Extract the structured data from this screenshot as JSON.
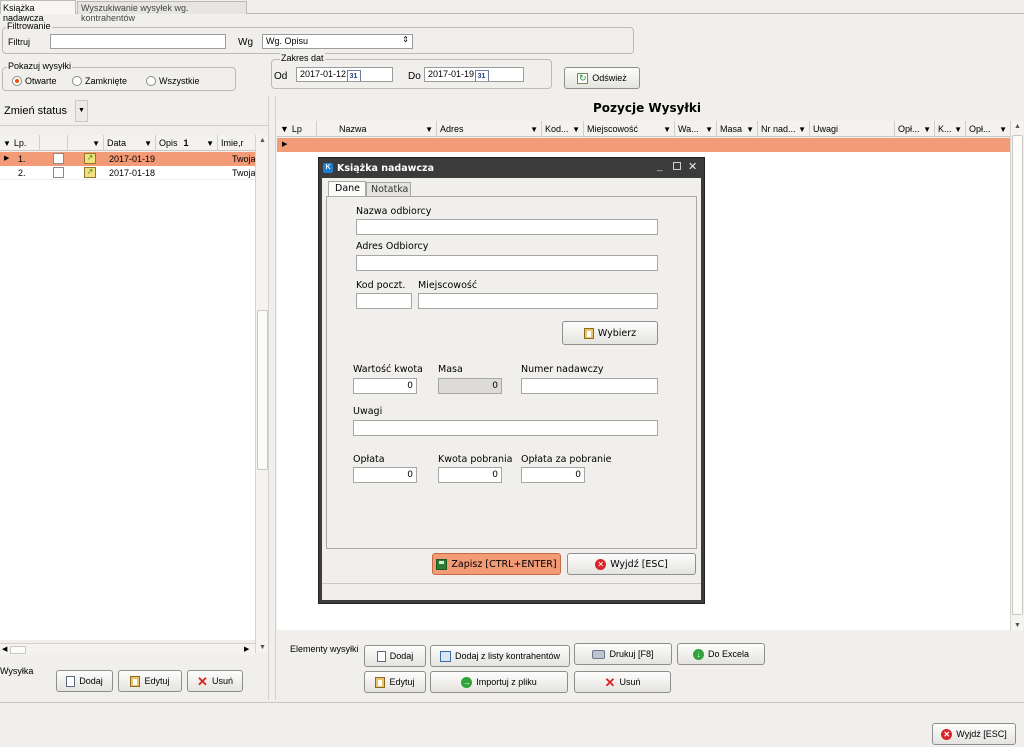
{
  "tabs": [
    {
      "label": "Książka nadawcza",
      "active": true
    },
    {
      "label": "Wyszukiwanie wysyłek wg. kontrahentów",
      "active": false
    }
  ],
  "filter": {
    "group_label": "Filtrowanie",
    "filtruj_label": "Filtruj",
    "filtruj_value": "",
    "wg_label": "Wg",
    "wg_value": "Wg. Opisu"
  },
  "show": {
    "group_label": "Pokazuj wysyłki",
    "options": [
      {
        "label": "Otwarte",
        "selected": true
      },
      {
        "label": "Zamknięte",
        "selected": false
      },
      {
        "label": "Wszystkie",
        "selected": false
      }
    ]
  },
  "dates": {
    "group_label": "Zakres dat",
    "from_label": "Od",
    "from_value": "2017-01-12",
    "to_label": "Do",
    "to_value": "2017-01-19",
    "cal_glyph": "31"
  },
  "refresh_label": "Odśwież",
  "status_label": "Zmień status",
  "left_table": {
    "headers": [
      "Lp.",
      "",
      "",
      "Data",
      "Opis",
      "Imie,r"
    ],
    "sort_glyph": "1",
    "rows": [
      {
        "lp": "1.",
        "date": "2017-01-19",
        "opis": "",
        "imie": "Twoja",
        "selected": true
      },
      {
        "lp": "2.",
        "date": "2017-01-18",
        "opis": "",
        "imie": "Twoja",
        "selected": false
      }
    ]
  },
  "left_bottom": {
    "label": "Wysyłka",
    "add": "Dodaj",
    "edit": "Edytuj",
    "delete": "Usuń"
  },
  "right": {
    "title": "Pozycje Wysyłki",
    "headers": [
      "Lp",
      "Nazwa",
      "Adres",
      "Kod...",
      "Miejscowość",
      "Wa...",
      "Masa",
      "Nr nad...",
      "Uwagi",
      "Opł...",
      "K...",
      "Opł..."
    ]
  },
  "elements": {
    "label": "Elementy wysyłki",
    "add": "Dodaj",
    "add_from_list": "Dodaj z listy kontrahentów",
    "print": "Drukuj  [F8]",
    "excel": "Do Excela",
    "edit": "Edytuj",
    "import": "Importuj z pliku",
    "delete": "Usuń"
  },
  "exit_main": "Wyjdź [ESC]",
  "dialog": {
    "title": "Książka nadawcza",
    "app_glyph": "K",
    "tabs": [
      "Dane",
      "Notatka"
    ],
    "recipient_name_label": "Nazwa odbiorcy",
    "recipient_name_value": "",
    "address_label": "Adres Odbiorcy",
    "address_value": "",
    "postcode_label": "Kod poczt.",
    "city_label": "Miejscowość",
    "choose": "Wybierz",
    "value_label": "Wartość kwota",
    "value": "0",
    "mass_label": "Masa",
    "mass": "0",
    "number_label": "Numer nadawczy",
    "notes_label": "Uwagi",
    "fee_label": "Opłata",
    "fee": "0",
    "cod_label": "Kwota pobrania",
    "cod": "0",
    "cod_fee_label": "Opłata za pobranie",
    "cod_fee": "0",
    "save": "Zapisz [CTRL+ENTER]",
    "exit": "Wyjdź [ESC]"
  },
  "colors": {
    "accent": "#f39a76",
    "selected_row": "#f39a76",
    "radio_on": "#e8510b"
  }
}
